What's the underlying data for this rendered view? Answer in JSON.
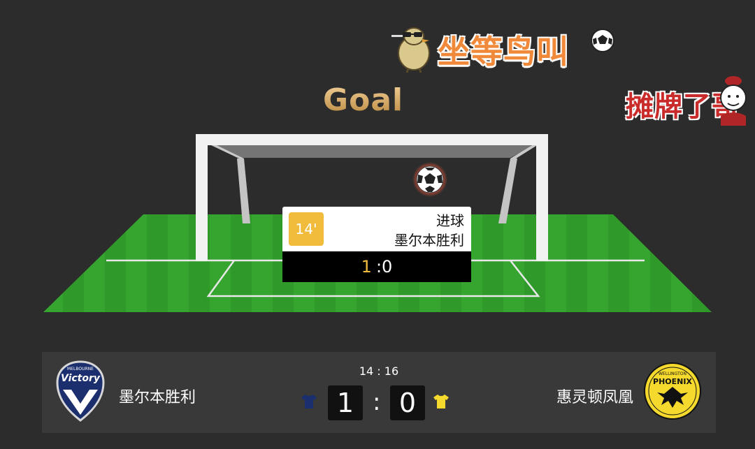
{
  "stickers": {
    "bird_text": "坐等鸟叫",
    "topper_text": "摊牌了哥"
  },
  "animation": {
    "title": "Goal"
  },
  "event": {
    "minute": "14'",
    "type": "进球",
    "team": "墨尔本胜利",
    "score_home": "1",
    "score_sep": ":",
    "score_away": "0"
  },
  "scoreboard": {
    "home_team": "墨尔本胜利",
    "away_team": "惠灵顿凤凰",
    "time": "14 : 16",
    "home_score": "1",
    "separator": ":",
    "away_score": "0",
    "home_logo_text": "Victory",
    "home_logo_small": "MELBOURNE",
    "away_logo_text": "PHOENIX",
    "away_logo_small": "WELLINGTON"
  },
  "colors": {
    "background": "#2c2c2c",
    "pitch": "#2f9a2a",
    "accent_gold": "#f1bc3c",
    "home_kit": "#1b2f6e",
    "away_kit": "#f5d92c"
  },
  "icons": [
    "bird-sticker-icon",
    "soccer-ball-icon",
    "person-sticker-icon",
    "home-kit-icon",
    "away-kit-icon"
  ]
}
